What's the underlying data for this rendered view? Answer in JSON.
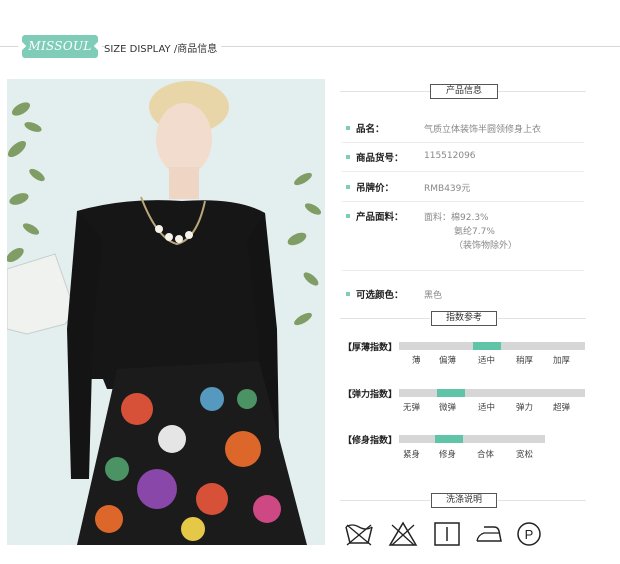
{
  "header": {
    "brand": "MISSOUL",
    "title": "SIZE DISPLAY /商品信息"
  },
  "product_info": {
    "section_title": "产品信息",
    "rows": [
      {
        "label": "品名：",
        "value": "气质立体装饰半圆领修身上衣"
      },
      {
        "label": "商品货号：",
        "value": "115512096"
      },
      {
        "label": "吊牌价：",
        "value": "RMB439元"
      },
      {
        "label": "产品面料：",
        "value_lines": [
          "面料：棉92.3%",
          "氨纶7.7%",
          "（装饰物除外）"
        ]
      },
      {
        "label": "可选颜色：",
        "value": "黑色"
      }
    ]
  },
  "index_reference": {
    "section_title": "指数参考",
    "indices": [
      {
        "label": "【厚薄指数】",
        "ticks": [
          "薄",
          "偏薄",
          "适中",
          "稍厚",
          "加厚"
        ],
        "selected": "适中",
        "selected_index": 2
      },
      {
        "label": "【弹力指数】",
        "ticks": [
          "无弹",
          "微弹",
          "适中",
          "弹力",
          "超弹"
        ],
        "selected": "微弹",
        "selected_index": 1
      },
      {
        "label": "【修身指数】",
        "ticks": [
          "紧身",
          "修身",
          "合体",
          "宽松"
        ],
        "selected": "修身",
        "selected_index": 1
      }
    ],
    "accent_color": "#5fc4a8"
  },
  "washing": {
    "section_title": "洗涤说明",
    "icons": [
      "no-wash-icon",
      "no-bleach-icon",
      "tumble-dry-line-icon",
      "iron-low-icon",
      "dry-clean-p-icon"
    ]
  },
  "colors": {
    "brand": "#7fcdb9",
    "bar": "#d6d6d6"
  }
}
